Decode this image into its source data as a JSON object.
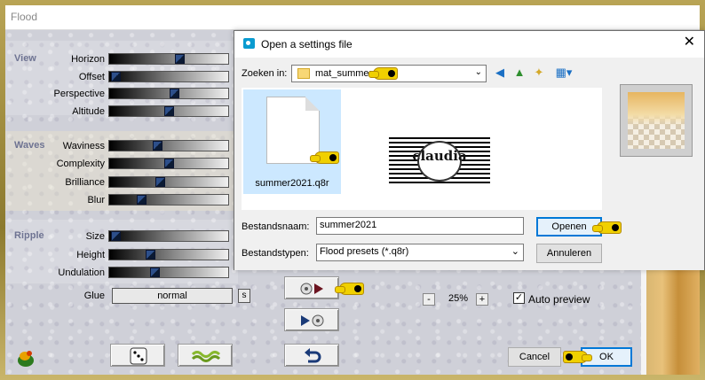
{
  "flood": {
    "title": "Flood",
    "groups": [
      {
        "label": "View",
        "params": [
          {
            "label": "Horizon",
            "value": 0.6
          },
          {
            "label": "Offset",
            "value": 0.02
          },
          {
            "label": "Perspective",
            "value": 0.55
          },
          {
            "label": "Altitude",
            "value": 0.5
          }
        ]
      },
      {
        "label": "Waves",
        "params": [
          {
            "label": "Waviness",
            "value": 0.4
          },
          {
            "label": "Complexity",
            "value": 0.5
          },
          {
            "label": "Brilliance",
            "value": 0.42
          },
          {
            "label": "Blur",
            "value": 0.25
          }
        ]
      },
      {
        "label": "Ripple",
        "params": [
          {
            "label": "Size",
            "value": 0.02
          },
          {
            "label": "Height",
            "value": 0.33
          },
          {
            "label": "Undulation",
            "value": 0.37
          }
        ]
      }
    ],
    "glue_label": "Glue",
    "glue_value": "normal",
    "glue_button": "s",
    "zoom_minus": "-",
    "zoom_value": "25%",
    "zoom_plus": "+",
    "auto_preview_label": "Auto preview",
    "auto_preview_checked": "✓",
    "cancel_label": "Cancel",
    "ok_label": "OK"
  },
  "dialog": {
    "title": "Open a settings file",
    "close": "✕",
    "look_in_label": "Zoeken in:",
    "look_in_value": "mat_summer",
    "chevron": "⌄",
    "files": [
      {
        "name": "summer2021.q8r"
      }
    ],
    "logo_text": "claudia",
    "filename_label": "Bestandsnaam:",
    "filename_value": "summer2021",
    "filetype_label": "Bestandstypen:",
    "filetype_value": "Flood presets (*.q8r)",
    "open_label": "Openen",
    "cancel_label": "Annuleren"
  },
  "colors": {
    "accent": "#0078d7",
    "selection": "#cce8ff",
    "group_label": "#6e7392"
  }
}
